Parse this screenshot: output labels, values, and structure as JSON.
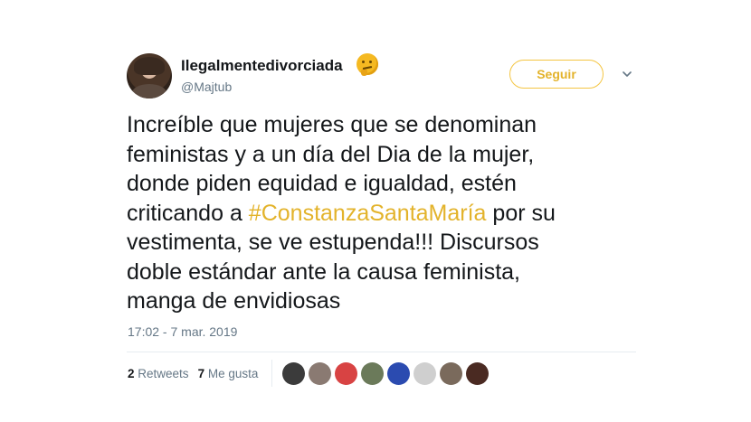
{
  "user": {
    "display_name": "Ilegalmentedivorciada",
    "emoji_icon": "thinking-face-icon",
    "handle": "@Majtub"
  },
  "follow_button": {
    "label": "Seguir"
  },
  "menu": {
    "icon": "chevron-down-icon"
  },
  "tweet": {
    "text_before": "Increíble que mujeres que se denominan\nfeministas y a un día del Dia de la mujer,\ndonde piden equidad e igualdad, estén\ncriticando a ",
    "hashtag": "#ConstanzaSantaMaría",
    "text_after": " por su\nvestimenta, se ve estupenda!!! Discursos\ndoble estándar ante la causa feminista,\nmanga de envidiosas"
  },
  "timestamp": "17:02 - 7 mar. 2019",
  "stats": {
    "retweets_count": "2",
    "retweets_label": "Retweets",
    "likes_count": "7",
    "likes_label": "Me gusta"
  },
  "colors": {
    "accent": "#e3b32b",
    "text": "#14171a",
    "muted": "#657786",
    "divider": "#e6ecf0"
  },
  "likers": [
    {
      "icon": "liker-avatar-1",
      "bg": "#3b3b3b"
    },
    {
      "icon": "liker-avatar-2",
      "bg": "#8a7a72"
    },
    {
      "icon": "liker-avatar-flag",
      "bg": "#d84343"
    },
    {
      "icon": "liker-avatar-4",
      "bg": "#6b7a5a"
    },
    {
      "icon": "liker-avatar-5",
      "bg": "#2b4bb0"
    },
    {
      "icon": "liker-avatar-dots",
      "bg": "#cfcfcf"
    },
    {
      "icon": "liker-avatar-7",
      "bg": "#7a6a5c"
    },
    {
      "icon": "liker-avatar-8",
      "bg": "#4a2a22"
    }
  ]
}
